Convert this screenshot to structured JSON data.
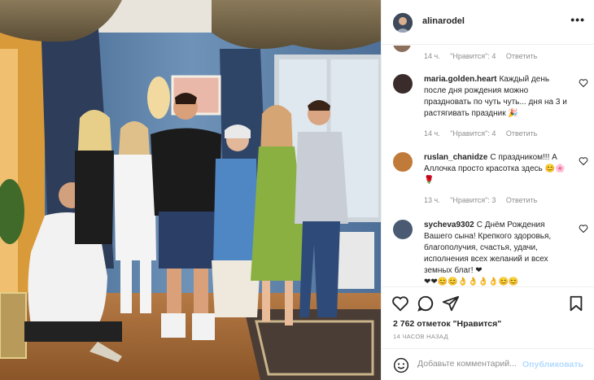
{
  "post": {
    "username": "alinarodel",
    "more_icon": "more-horizontal-icon",
    "photo_alt": "Group photo of seven people in a living room"
  },
  "comments": [
    {
      "meta": {
        "time": "14 ч.",
        "likes": "\"Нравится\": 4",
        "reply": "Ответить"
      }
    },
    {
      "username": "maria.golden.heart",
      "text": "Каждый день после дня рождения можно праздновать по чуть чуть... дня на 3 и растягивать праздник 🎉",
      "meta": {
        "time": "14 ч.",
        "likes": "\"Нравится\": 4",
        "reply": "Ответить"
      },
      "avatar_color": "#3a2c2a"
    },
    {
      "username": "ruslan_chanidze",
      "text": "С праздником!!! А Аллочка просто красотка здесь 😊🌸🌹",
      "meta": {
        "time": "13 ч.",
        "likes": "\"Нравится\": 3",
        "reply": "Ответить"
      },
      "avatar_color": "#c07a3a"
    },
    {
      "username": "sycheva9302",
      "text": "С Днём Рождения Вашего сына! Крепкого здоровья, благополучия, счастья, удачи, исполнения всех желаний и всех земных благ! ❤",
      "emoji_row": "❤❤😊😊👌👌👌👌😊😊",
      "avatar_color": "#4a5a72"
    }
  ],
  "actions": {
    "likes_count": "2 762 отметок \"Нравится\"",
    "posted_time": "14 ЧАСОВ НАЗАД"
  },
  "composer": {
    "placeholder": "Добавьте комментарий...",
    "post_label": "Опубликовать"
  }
}
